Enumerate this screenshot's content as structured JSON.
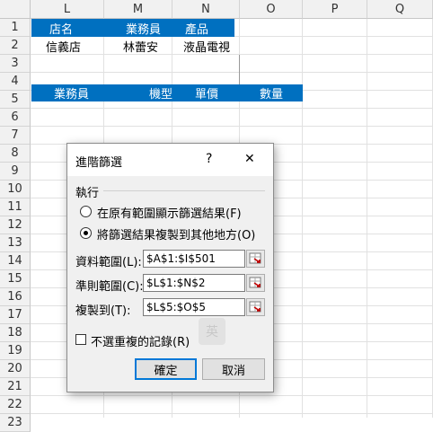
{
  "columns": [
    "L",
    "M",
    "N",
    "O",
    "P",
    "Q"
  ],
  "rows": [
    "1",
    "2",
    "3",
    "4",
    "5",
    "6",
    "7",
    "8",
    "9",
    "10",
    "11",
    "12",
    "13",
    "14",
    "15",
    "16",
    "17",
    "18",
    "19",
    "20",
    "21",
    "22",
    "23"
  ],
  "cells": {
    "L1": "店名",
    "M1": "業務員",
    "N1": "產品",
    "L2": "信義店",
    "M2": "林蕾安",
    "N2": "液晶電視",
    "L5": "業務員",
    "M5": "機型",
    "N5": "單價",
    "O5": "數量"
  },
  "dialog": {
    "title": "進階篩選",
    "help": "?",
    "close": "✕",
    "group_label": "執行",
    "option1": "在原有範圍顯示篩選結果(F)",
    "option2": "將篩選結果複製到其他地方(O)",
    "option2_selected": true,
    "list_range_label": "資料範圍(L):",
    "list_range_value": "$A$1:$I$501",
    "criteria_label": "準則範圍(C):",
    "criteria_value": "$L$1:$N$2",
    "copy_to_label": "複製到(T):",
    "copy_to_value": "$L$5:$O$5",
    "unique_label": "不選重複的記錄(R)",
    "unique_checked": false,
    "ok": "確定",
    "cancel": "取消",
    "ime_badge": "英"
  },
  "colors": {
    "header_fill": "#0070c0",
    "header_text": "#ffffff"
  }
}
